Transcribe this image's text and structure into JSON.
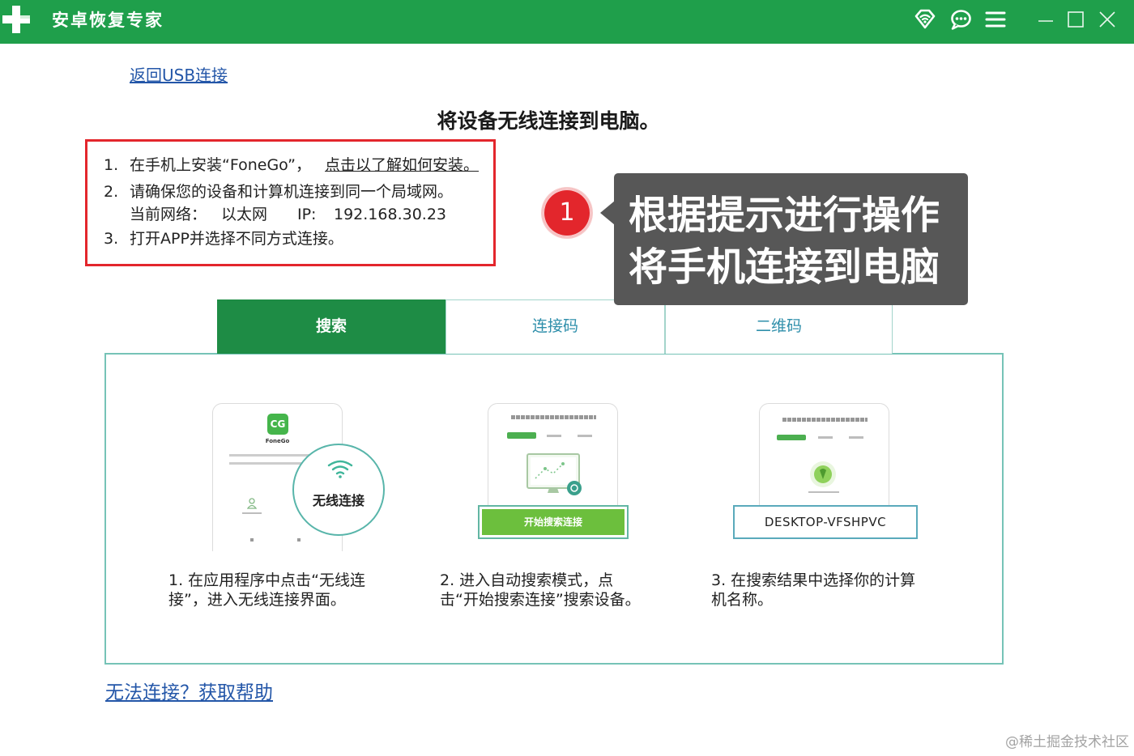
{
  "colors": {
    "brand_green": "#1f9f4b",
    "active_tab": "#1e8c45",
    "link": "#2356a8",
    "highlight_red": "#e3262c",
    "callout_bg": "#575757",
    "panel_border": "#76c3b7",
    "inactive_tab_text": "#2f8fab"
  },
  "icons": {
    "app_logo": "plus-logo-icon",
    "title_bar": [
      "wifi-diamond-icon",
      "chat-icon",
      "menu-icon",
      "minimize-icon",
      "maximize-icon",
      "close-icon"
    ],
    "overlay": "wifi-icon"
  },
  "window": {
    "title": "安卓恢复专家"
  },
  "back_link": "返回USB连接",
  "heading": "将设备无线连接到电脑。",
  "instructions": {
    "step1": {
      "num": "1.",
      "text": "在手机上安装“FoneGo”，",
      "link": "点击以了解如何安装。"
    },
    "step2": {
      "num": "2.",
      "text": "请确保您的设备和计算机连接到同一个局域网。"
    },
    "network": {
      "label": "当前网络：",
      "type": "以太网",
      "ip_label": "IP:",
      "ip": "192.168.30.23"
    },
    "step3": {
      "num": "3.",
      "text": "打开APP并选择不同方式连接。"
    }
  },
  "annotation": {
    "badge": "1",
    "lines": [
      "根据提示进行操作",
      "将手机连接到电脑"
    ]
  },
  "tabs": [
    {
      "label": "搜索",
      "active": true
    },
    {
      "label": "连接码",
      "active": false
    },
    {
      "label": "二维码",
      "active": false
    }
  ],
  "cards": [
    {
      "logo_text": "CG",
      "app_name": "FoneGo",
      "overlay_label": "无线连接",
      "caption_lines": [
        "1. 在应用程序中点击“无线连",
        "接”，进入无线连接界面。"
      ]
    },
    {
      "button_label": "开始搜索连接",
      "caption_lines": [
        "2. 进入自动搜索模式，点",
        "击“开始搜索连接”搜索设备。"
      ]
    },
    {
      "device_name": "DESKTOP-VFSHPVC",
      "caption_lines": [
        "3. 在搜索结果中选择你的计算",
        "机名称。"
      ]
    }
  ],
  "help_link": "无法连接？获取帮助",
  "watermark": "@稀土掘金技术社区"
}
